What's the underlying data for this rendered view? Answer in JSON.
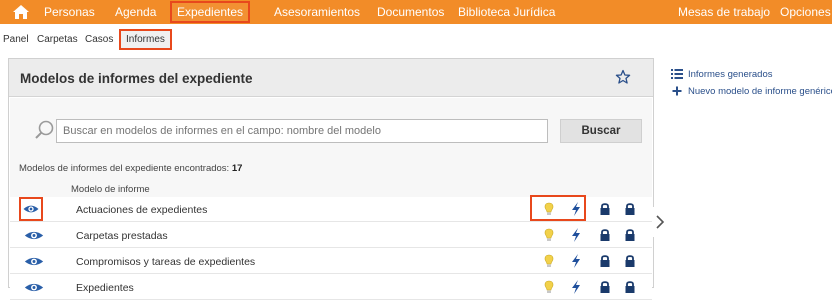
{
  "topnav": {
    "items": [
      {
        "label": "Personas"
      },
      {
        "label": "Agenda"
      },
      {
        "label": "Expedientes"
      },
      {
        "label": "Asesoramientos"
      },
      {
        "label": "Documentos"
      },
      {
        "label": "Biblioteca Jurídica"
      }
    ],
    "right_items": [
      {
        "label": "Mesas de trabajo"
      },
      {
        "label": "Opciones"
      }
    ],
    "active_index": 2
  },
  "subnav": {
    "items": [
      {
        "label": "Panel"
      },
      {
        "label": "Carpetas"
      },
      {
        "label": "Casos"
      },
      {
        "label": "Informes"
      }
    ],
    "active_index": 3
  },
  "panel": {
    "title": "Modelos de informes del expediente",
    "search": {
      "placeholder": "Buscar en modelos de informes en el campo: nombre del modelo",
      "button_label": "Buscar"
    },
    "found_label": "Modelos de informes del expediente encontrados:",
    "found_count": "17",
    "column_header": "Modelo de informe",
    "rows": [
      {
        "label": "Actuaciones de expedientes"
      },
      {
        "label": "Carpetas prestadas"
      },
      {
        "label": "Compromisos y tareas de expedientes"
      },
      {
        "label": "Expedientes"
      }
    ]
  },
  "sidebar": {
    "links": [
      {
        "label": "Informes generados"
      },
      {
        "label": "Nuevo modelo de informe genérico"
      }
    ]
  },
  "colors": {
    "topbar": "#f28c28",
    "highlight": "#e8481c",
    "eye_blue": "#2a5fa8",
    "bulb_yellow": "#f2d14a",
    "bolt_blue": "#1f4f9c",
    "lock_navy": "#1a3a6b"
  }
}
